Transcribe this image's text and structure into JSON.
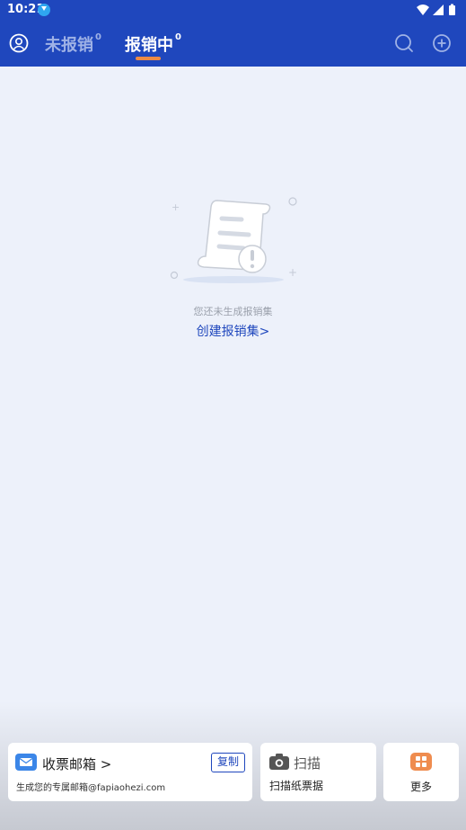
{
  "status_bar": {
    "time": "10:21"
  },
  "nav": {
    "tabs": [
      {
        "label": "未报销",
        "count": "0"
      },
      {
        "label": "报销中",
        "count": "0"
      }
    ]
  },
  "empty_state": {
    "message": "您还未生成报销集",
    "action": "创建报销集>"
  },
  "bottom_cards": {
    "mailbox": {
      "title": "收票邮箱",
      "copy_label": "复制",
      "subtitle": "生成您的专属邮箱@fapiaohezi.com"
    },
    "scan": {
      "label": "扫描",
      "sub": "扫描纸票据"
    },
    "more": {
      "label": "更多"
    }
  },
  "colors": {
    "header": "#1f47bd",
    "accent_underline": "#ee8b45",
    "background": "#edf1fa",
    "mail_icon": "#3b86e8",
    "more_icon": "#ef8c4f"
  }
}
